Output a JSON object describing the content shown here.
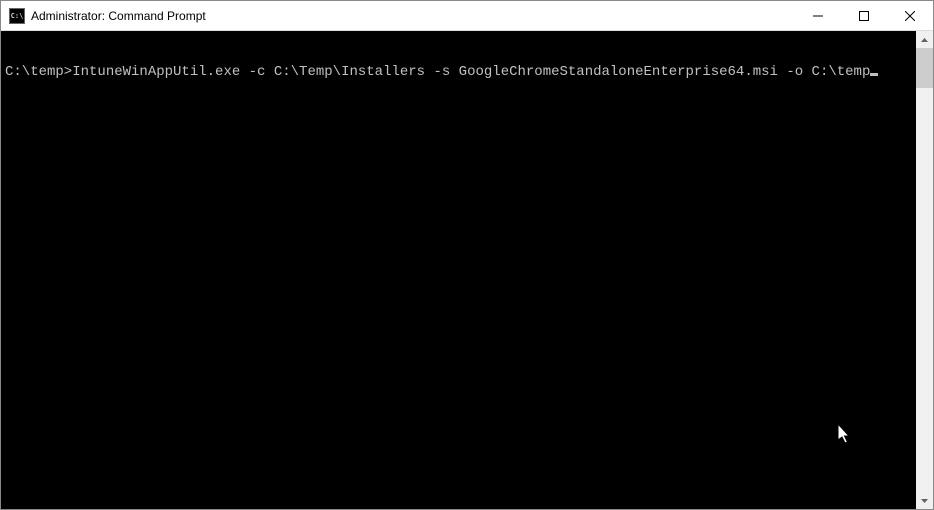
{
  "titlebar": {
    "icon_text": "C:\\",
    "title": "Administrator: Command Prompt"
  },
  "console": {
    "prompt": "C:\\temp>",
    "command": "IntuneWinAppUtil.exe -c C:\\Temp\\Installers -s GoogleChromeStandaloneEnterprise64.msi -o C:\\temp"
  }
}
